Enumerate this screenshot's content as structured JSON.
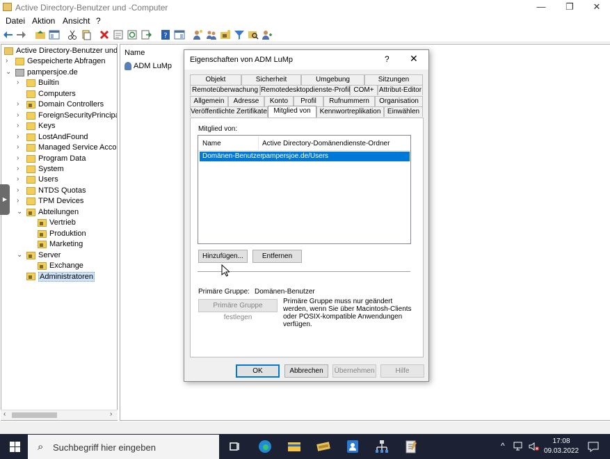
{
  "window": {
    "title": "Active Directory-Benutzer und -Computer",
    "minimize_icon": "minimize-icon",
    "restore_icon": "restore-icon",
    "close_icon": "close-icon"
  },
  "menu": {
    "items": [
      "Datei",
      "Aktion",
      "Ansicht",
      "?"
    ]
  },
  "toolbar": {
    "icons": [
      "back-icon",
      "forward-icon",
      "up-folder-icon",
      "show-console-tree-icon",
      "cut-icon",
      "copy-icon",
      "delete-icon",
      "properties-icon",
      "refresh-icon",
      "export-list-icon",
      "help-icon",
      "show-hide-icon",
      "new-user-icon",
      "new-group-icon",
      "new-ou-icon",
      "filter-icon",
      "find-icon",
      "add-to-group-icon"
    ]
  },
  "tree": {
    "nodes": [
      {
        "label": "Active Directory-Benutzer und -",
        "level": 0,
        "expander": "",
        "kind": "root"
      },
      {
        "label": "Gespeicherte Abfragen",
        "level": 1,
        "expander": "›",
        "kind": "folder"
      },
      {
        "label": "pampersjoe.de",
        "level": 1,
        "expander": "⌄",
        "kind": "domain"
      },
      {
        "label": "Builtin",
        "level": 2,
        "expander": "›",
        "kind": "folder"
      },
      {
        "label": "Computers",
        "level": 2,
        "expander": "",
        "kind": "folder"
      },
      {
        "label": "Domain Controllers",
        "level": 2,
        "expander": "›",
        "kind": "ou"
      },
      {
        "label": "ForeignSecurityPrincipals",
        "level": 2,
        "expander": "›",
        "kind": "folder"
      },
      {
        "label": "Keys",
        "level": 2,
        "expander": "›",
        "kind": "folder"
      },
      {
        "label": "LostAndFound",
        "level": 2,
        "expander": "›",
        "kind": "folder"
      },
      {
        "label": "Managed Service Accounts",
        "level": 2,
        "expander": "›",
        "kind": "folder"
      },
      {
        "label": "Program Data",
        "level": 2,
        "expander": "›",
        "kind": "folder"
      },
      {
        "label": "System",
        "level": 2,
        "expander": "›",
        "kind": "folder"
      },
      {
        "label": "Users",
        "level": 2,
        "expander": "›",
        "kind": "folder"
      },
      {
        "label": "NTDS Quotas",
        "level": 2,
        "expander": "›",
        "kind": "folder"
      },
      {
        "label": "TPM Devices",
        "level": 2,
        "expander": "›",
        "kind": "folder"
      },
      {
        "label": "Abteilungen",
        "level": 2,
        "expander": "⌄",
        "kind": "ou"
      },
      {
        "label": "Vertrieb",
        "level": 3,
        "expander": "",
        "kind": "ou"
      },
      {
        "label": "Produktion",
        "level": 3,
        "expander": "",
        "kind": "ou"
      },
      {
        "label": "Marketing",
        "level": 3,
        "expander": "",
        "kind": "ou"
      },
      {
        "label": "Server",
        "level": 2,
        "expander": "⌄",
        "kind": "ou"
      },
      {
        "label": "Exchange",
        "level": 3,
        "expander": "",
        "kind": "ou"
      },
      {
        "label": "Administratoren",
        "level": 2,
        "expander": "",
        "kind": "ou",
        "selected": true
      }
    ]
  },
  "list": {
    "column_name": "Name",
    "items": [
      "ADM LuMp"
    ]
  },
  "dialog": {
    "title": "Eigenschaften von ADM LuMp",
    "help": "?",
    "close": "✕",
    "tabs_row1": [
      "Objekt",
      "Sicherheit",
      "Umgebung",
      "Sitzungen"
    ],
    "tabs_row2": [
      "Remoteüberwachung",
      "Remotedesktopdienste-Profil",
      "COM+",
      "Attribut-Editor"
    ],
    "tabs_row3": [
      "Allgemein",
      "Adresse",
      "Konto",
      "Profil",
      "Rufnummern",
      "Organisation"
    ],
    "tabs_row4": [
      "Veröffentlichte Zertifikate",
      "Mitglied von",
      "Kennwortreplikation",
      "Einwählen"
    ],
    "active_tab": "Mitglied von",
    "member_of_label": "Mitglied von:",
    "columns": [
      "Name",
      "Active Directory-Domänendienste-Ordner"
    ],
    "rows": [
      {
        "name": "Domänen-Benutzer",
        "folder": "pampersjoe.de/Users",
        "selected": true
      }
    ],
    "add_button": "Hinzufügen...",
    "remove_button": "Entfernen",
    "primary_group_label": "Primäre Gruppe:",
    "primary_group_value": "Domänen-Benutzer",
    "set_primary_button": "Primäre Gruppe festlegen",
    "note": "Primäre Gruppe muss nur geändert werden, wenn Sie über Macintosh-Clients oder POSIX-kompatible Anwendungen verfügen.",
    "ok_button": "OK",
    "cancel_button": "Abbrechen",
    "apply_button": "Übernehmen",
    "help_button": "Hilfe"
  },
  "taskbar": {
    "search_placeholder": "Suchbegriff hier eingeben",
    "apps": [
      "task-view-icon",
      "edge-icon",
      "file-explorer-icon",
      "ad-users-icon",
      "contacts-icon",
      "network-icon",
      "notepad-icon"
    ],
    "time": "17:08",
    "date": "09.03.2022"
  },
  "colors": {
    "selection": "#0078d7",
    "taskbar": "#1c2133",
    "folder": "#f2cf5b"
  }
}
